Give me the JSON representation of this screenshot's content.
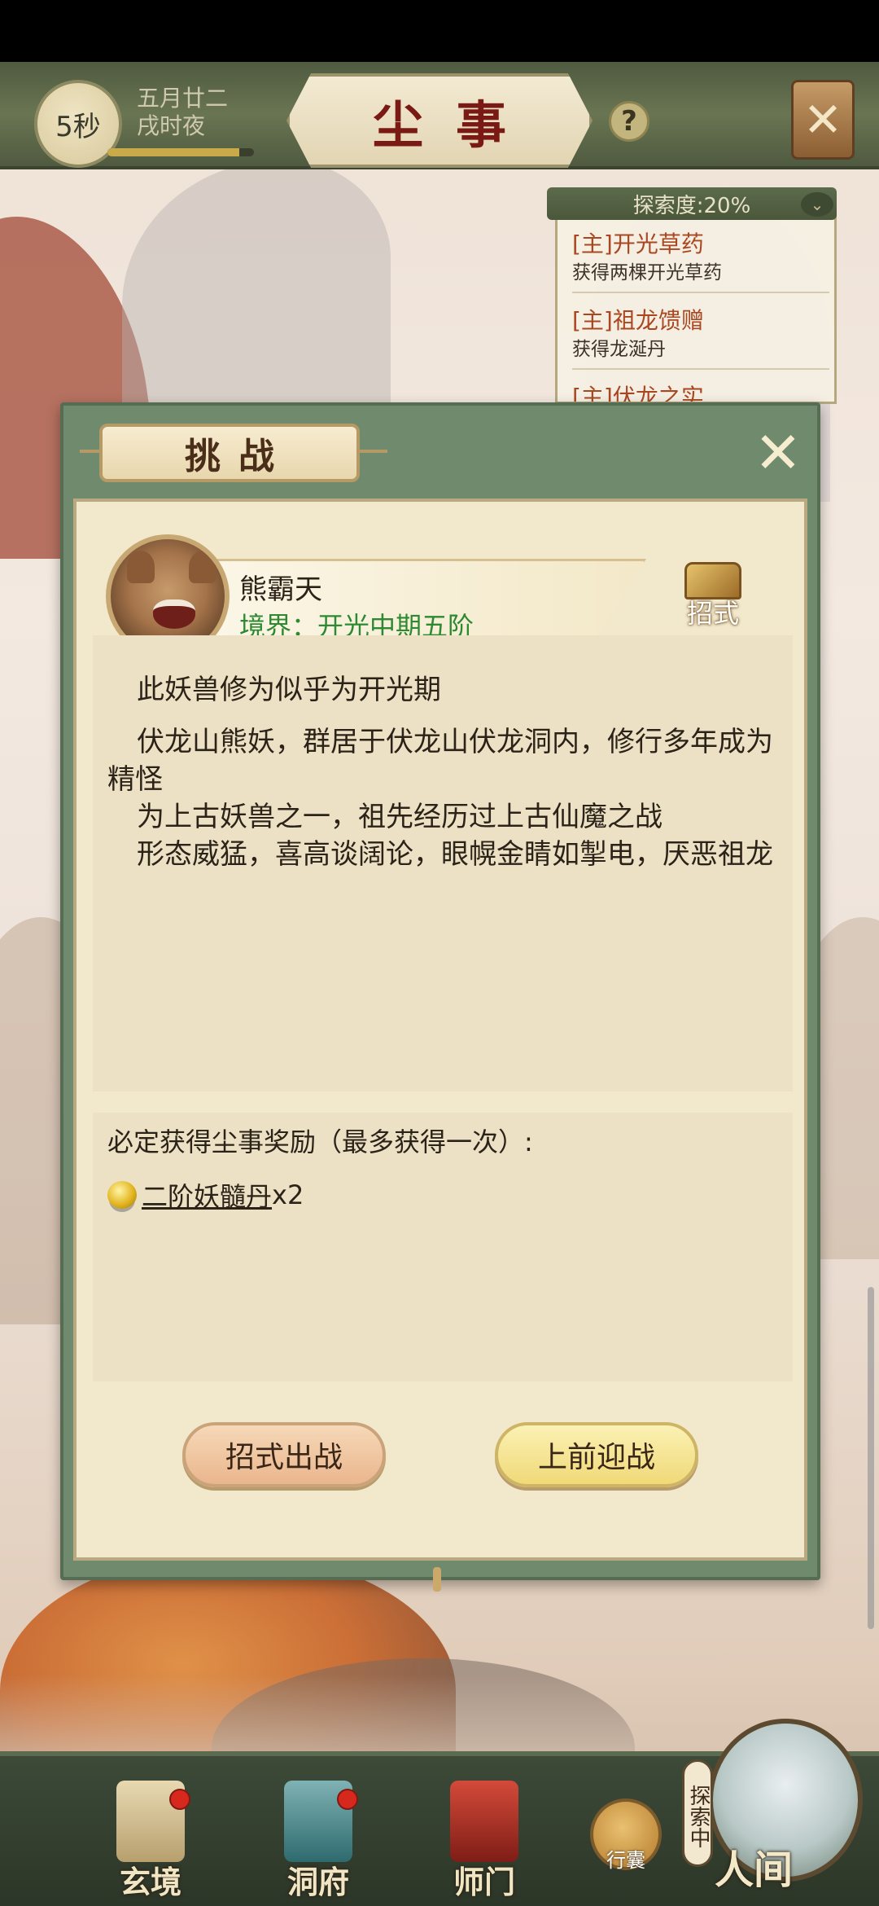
{
  "top_bar": {
    "timer": "5秒",
    "date_line1": "五月廿二",
    "date_line2": "戌时夜",
    "title": "尘事",
    "help": "?"
  },
  "quest_panel": {
    "header": "探索度:20%",
    "items": [
      {
        "title": "[主]开光草药",
        "sub": "获得两棵开光草药"
      },
      {
        "title": "[主]祖龙馈赠",
        "sub": "获得龙涎丹"
      },
      {
        "title": "[主]伏龙之实",
        "sub": ""
      }
    ]
  },
  "dialog": {
    "tab_title": "挑战",
    "npc": {
      "name": "熊霸天",
      "realm": "境界：开光中期五阶"
    },
    "skills_label": "招式",
    "description": [
      "此妖兽修为似乎为开光期",
      "伏龙山熊妖，群居于伏龙山伏龙洞内，修行多年成为精怪",
      "为上古妖兽之一，祖先经历过上古仙魔之战",
      "形态威猛，喜高谈阔论，眼幌金睛如掣电，厌恶祖龙"
    ],
    "reward_title": "必定获得尘事奖励（最多获得一次）:",
    "reward": {
      "name": "二阶妖髓丹",
      "qty": "x2"
    },
    "buttons": {
      "skill_battle": "招式出战",
      "fight": "上前迎战"
    }
  },
  "bottom_nav": {
    "items": [
      "玄境",
      "洞府",
      "师门"
    ],
    "bag": "行囊",
    "explore_badge": "探索中",
    "world": "人间"
  },
  "colors": {
    "accent_green": "#6f8a6c",
    "realm_green": "#2d8a32",
    "quest_orange": "#a94720",
    "title_red": "#7a1a14"
  }
}
